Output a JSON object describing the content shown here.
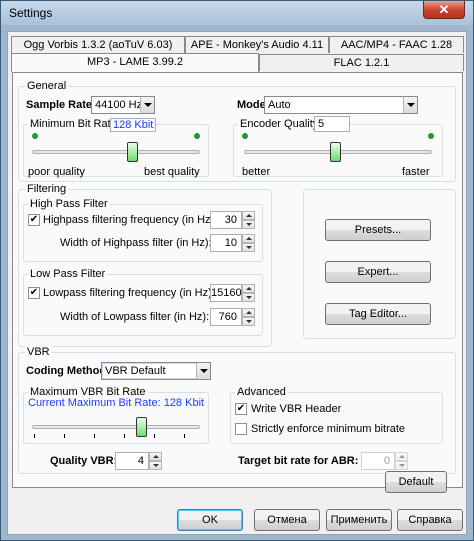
{
  "window": {
    "title": "Settings",
    "close_label": "✕"
  },
  "tabs": {
    "row1": [
      "Ogg Vorbis 1.3.2 (aoTuV 6.03)",
      "APE - Monkey's Audio 4.11",
      "AAC/MP4 - FAAC 1.28"
    ],
    "row2": [
      "MP3 - LAME 3.99.2",
      "FLAC 1.2.1"
    ],
    "active": "MP3 - LAME 3.99.2"
  },
  "general": {
    "label": "General",
    "sample_rate_label": "Sample Rate:",
    "sample_rate_value": "44100 Hz",
    "mode_label": "Mode:",
    "mode_value": "Auto",
    "min_bitrate_label": "Minimum Bit Rate:",
    "min_bitrate_value": "128 Kbit",
    "min_bitrate_left": "poor quality",
    "min_bitrate_right": "best quality",
    "encoder_quality_label": "Encoder Quality:",
    "encoder_quality_value": "5",
    "encoder_left": "better",
    "encoder_right": "faster"
  },
  "filtering": {
    "label": "Filtering",
    "high_pass_label": "High Pass Filter",
    "highpass_check_label": "Highpass filtering frequency (in Hz):",
    "highpass_value": "30",
    "highpass_width_label": "Width of Highpass filter (in Hz):",
    "highpass_width_value": "10",
    "low_pass_label": "Low Pass Filter",
    "lowpass_check_label": "Lowpass filtering frequency (in Hz):",
    "lowpass_value": "15160",
    "lowpass_width_label": "Width of Lowpass filter (in Hz):",
    "lowpass_width_value": "760"
  },
  "side_buttons": {
    "presets": "Presets...",
    "expert": "Expert...",
    "tag_editor": "Tag Editor..."
  },
  "vbr": {
    "label": "VBR",
    "coding_method_label": "Coding Method:",
    "coding_method_value": "VBR Default",
    "max_bitrate_label": "Maximum VBR Bit Rate",
    "current_max_label": "Current Maximum Bit Rate: 128 Kbit",
    "quality_label": "Quality VBR:",
    "quality_value": "4",
    "advanced_label": "Advanced",
    "write_header_label": "Write VBR Header",
    "strict_min_label": "Strictly enforce minimum bitrate",
    "target_abr_label": "Target bit rate for ABR:",
    "target_abr_value": "0"
  },
  "default_button": "Default",
  "footer": {
    "ok": "OK",
    "cancel": "Отмена",
    "apply": "Применить",
    "help": "Справка"
  },
  "checks": {
    "highpass": true,
    "lowpass": true,
    "write_header": true,
    "strict_min": false,
    "mark": "✔"
  },
  "colors": {
    "accent_blue": "#1a3cff",
    "thumb_green": "#6ddc6d",
    "dot_green": "#1c9a2c"
  }
}
